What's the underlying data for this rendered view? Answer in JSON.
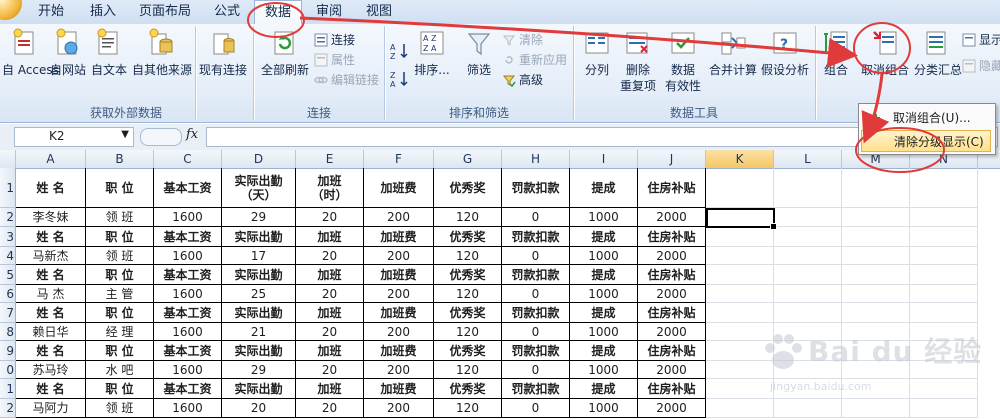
{
  "tabs": [
    {
      "label": "开始",
      "active": false
    },
    {
      "label": "插入",
      "active": false
    },
    {
      "label": "页面布局",
      "active": false
    },
    {
      "label": "公式",
      "active": false
    },
    {
      "label": "数据",
      "active": true
    },
    {
      "label": "审阅",
      "active": false
    },
    {
      "label": "视图",
      "active": false
    }
  ],
  "ribbon": {
    "external": {
      "label": "获取外部数据",
      "access": "自 Access",
      "web": "自网站",
      "text": "自文本",
      "other": "自其他来源",
      "existing": "现有连接"
    },
    "connections": {
      "label": "连接",
      "refresh_all": "全部刷新",
      "connections": "连接",
      "properties": "属性",
      "edit_links": "编辑链接"
    },
    "sortfilter": {
      "label": "排序和筛选",
      "sort": "排序...",
      "filter": "筛选",
      "clear": "清除",
      "reapply": "重新应用",
      "advanced": "高级"
    },
    "datatools": {
      "label": "数据工具",
      "split": "分列",
      "remove_dup_1": "删除",
      "remove_dup_2": "重复项",
      "validation_1": "数据",
      "validation_2": "有效性",
      "consolidate": "合并计算",
      "whatif": "假设分析"
    },
    "outline": {
      "group": "组合",
      "ungroup": "取消组合",
      "subtotal": "分类汇总",
      "show": "显示",
      "hide": "隐藏"
    }
  },
  "namebox": "K2",
  "fx": "fx",
  "dropdown": {
    "item1": "取消组合(U)...",
    "item2": "清除分级显示(C)"
  },
  "sheet": {
    "columns": [
      "A",
      "B",
      "C",
      "D",
      "E",
      "F",
      "G",
      "H",
      "I",
      "J",
      "K",
      "L",
      "M",
      "N"
    ],
    "row_labels": [
      "1",
      "2",
      "3",
      "4",
      "5",
      "6",
      "7",
      "8",
      "9",
      "0",
      "1",
      "2"
    ],
    "header_row": [
      "姓 名",
      "职 位",
      "基本工资",
      "实际出勤\n（天）",
      "加班\n（时）",
      "加班费",
      "优秀奖",
      "罚款扣款",
      "提成",
      "住房补贴"
    ],
    "repeat_header": [
      "姓 名",
      "职 位",
      "基本工资",
      "实际出勤",
      "加班",
      "加班费",
      "优秀奖",
      "罚款扣款",
      "提成",
      "住房补贴"
    ],
    "records": [
      [
        "李冬妹",
        "领 班",
        "1600",
        "29",
        "20",
        "200",
        "120",
        "0",
        "1000",
        "2000"
      ],
      [
        "马新杰",
        "领 班",
        "1600",
        "17",
        "20",
        "200",
        "120",
        "0",
        "1000",
        "2000"
      ],
      [
        "马 杰",
        "主 管",
        "1600",
        "25",
        "20",
        "200",
        "120",
        "0",
        "1000",
        "2000"
      ],
      [
        "赖日华",
        "经 理",
        "1600",
        "21",
        "20",
        "200",
        "120",
        "0",
        "1000",
        "2000"
      ],
      [
        "苏马玲",
        "水 吧",
        "1600",
        "29",
        "20",
        "200",
        "120",
        "0",
        "1000",
        "2000"
      ],
      [
        "马阿力",
        "领 班",
        "1600",
        "20",
        "20",
        "200",
        "120",
        "0",
        "1000",
        "2000"
      ]
    ]
  },
  "watermark": {
    "brand": "Bai du 经验",
    "url": "jingyan.baidu.com"
  },
  "colors": {
    "annotation": "#e03a3a",
    "selection_header": "#f5c763",
    "ribbon_bg": "#e4edf8"
  }
}
